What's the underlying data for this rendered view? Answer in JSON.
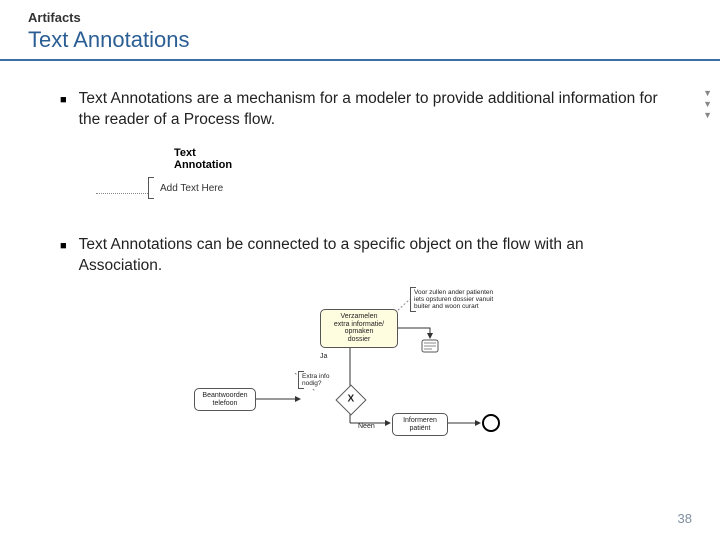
{
  "header": {
    "kicker": "Artifacts",
    "title": "Text Annotations"
  },
  "bullets": [
    "Text Annotations are a mechanism for a modeler to provide additional information for the reader of a Process flow.",
    "Text Annotations can be connected to a specific object on the flow with an Association."
  ],
  "illus1": {
    "label_line1": "Text",
    "label_line2": "Annotation",
    "hint": "Add Text Here"
  },
  "illus2": {
    "note_top": "Voor zullen ander patienten iets opsturen dossier vanuit buiter and woon curart",
    "task_main_l1": "Verzamelen",
    "task_main_l2": "extra informatie/",
    "task_main_l3": "opmaken",
    "task_main_l4": "dossier",
    "task_left_l1": "Beantwoorden",
    "task_left_l2": "telefoon",
    "task_bottom_l1": "Informeren",
    "task_bottom_l2": "patiënt",
    "note_mid": "Extra info nodig?",
    "gateway": "X",
    "label_yes": "Ja",
    "label_no": "Neen"
  },
  "sidemarks": {
    "a": "▼",
    "b": "▼",
    "c": "▼"
  },
  "page": "38"
}
